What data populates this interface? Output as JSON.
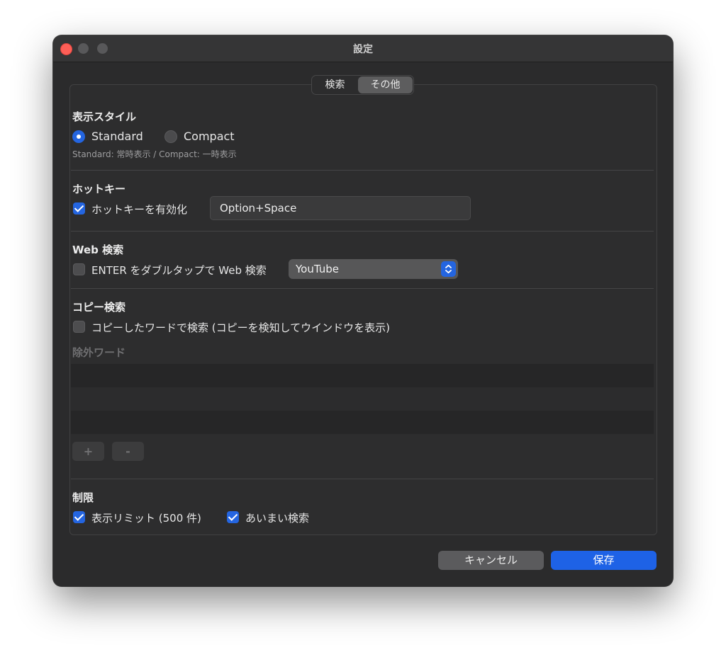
{
  "window": {
    "title": "設定"
  },
  "tabs": {
    "search": "検索",
    "other": "その他",
    "selected": "その他"
  },
  "display_style": {
    "title": "表示スタイル",
    "options": [
      "Standard",
      "Compact"
    ],
    "selected": "Standard",
    "hint": "Standard: 常時表示 / Compact: 一時表示"
  },
  "hotkey": {
    "title": "ホットキー",
    "enable_label": "ホットキーを有効化",
    "enabled": true,
    "value": "Option+Space"
  },
  "web_search": {
    "title": "Web 検索",
    "double_tap_label": "ENTER をダブルタップで Web 検索",
    "enabled": false,
    "engine": "YouTube"
  },
  "copy_search": {
    "title": "コピー検索",
    "enable_label": "コピーしたワードで検索 (コピーを検知してウインドウを表示)",
    "enabled": false,
    "exclude_title": "除外ワード",
    "exclude_words": [],
    "add_label": "+",
    "remove_label": "-"
  },
  "limits": {
    "title": "制限",
    "display_limit_label": "表示リミット (500 件)",
    "display_limit_enabled": true,
    "fuzzy_label": "あいまい検索",
    "fuzzy_enabled": true
  },
  "buttons": {
    "cancel": "キャンセル",
    "save": "保存"
  },
  "colors": {
    "accent": "#2465e0",
    "close": "#fe5f57",
    "background": "#2b2b2c"
  }
}
